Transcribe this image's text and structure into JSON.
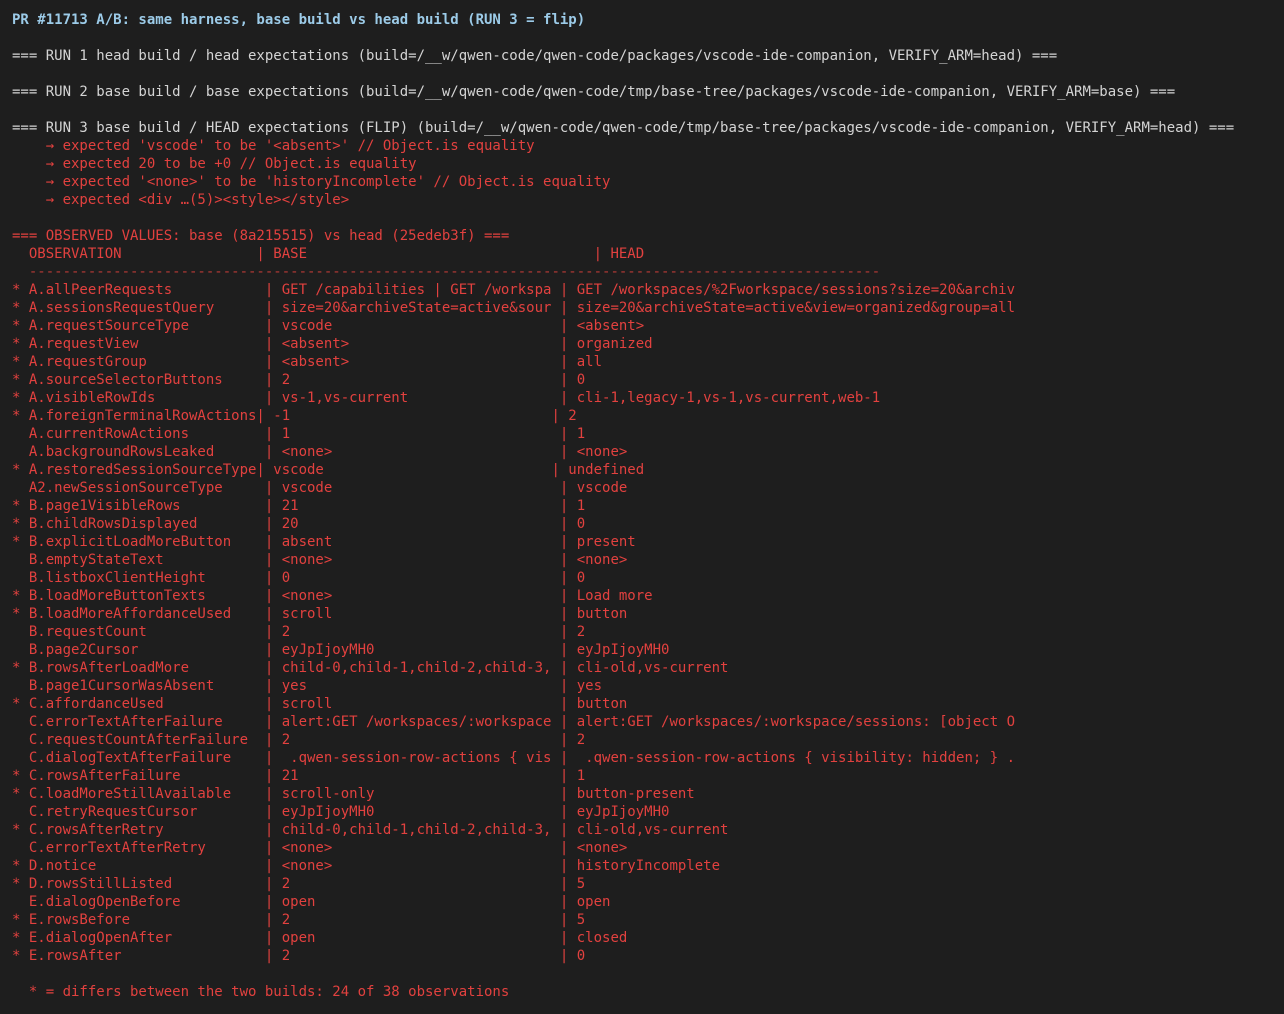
{
  "title": "PR #11713 A/B: same harness, base build vs head build (RUN 3 = flip)",
  "runs": [
    "=== RUN 1 head build / head expectations (build=/__w/qwen-code/qwen-code/packages/vscode-ide-companion, VERIFY_ARM=head) ===",
    "=== RUN 2 base build / base expectations (build=/__w/qwen-code/qwen-code/tmp/base-tree/packages/vscode-ide-companion, VERIFY_ARM=base) ===",
    "=== RUN 3 base build / HEAD expectations (FLIP) (build=/__w/qwen-code/qwen-code/tmp/base-tree/packages/vscode-ide-companion, VERIFY_ARM=head) ==="
  ],
  "failures": [
    "    → expected 'vscode' to be '<absent>' // Object.is equality",
    "    → expected 20 to be +0 // Object.is equality",
    "    → expected '<none>' to be 'historyIncomplete' // Object.is equality",
    "    → expected <div …(5)><style></style>"
  ],
  "observed_header": "=== OBSERVED VALUES: base (8a215515) vs head (25edeb3f) ===",
  "table_header": "  OBSERVATION                | BASE                                  | HEAD",
  "table_separator": "  -----------------------------------------------------------------------------------------------------",
  "rows": [
    "* A.allPeerRequests           | GET /capabilities | GET /workspa | GET /workspaces/%2Fworkspace/sessions?size=20&archiv",
    "* A.sessionsRequestQuery      | size=20&archiveState=active&sour | size=20&archiveState=active&view=organized&group=all",
    "* A.requestSourceType         | vscode                           | <absent>",
    "* A.requestView               | <absent>                         | organized",
    "* A.requestGroup              | <absent>                         | all",
    "* A.sourceSelectorButtons     | 2                                | 0",
    "* A.visibleRowIds             | vs-1,vs-current                  | cli-1,legacy-1,vs-1,vs-current,web-1",
    "* A.foreignTerminalRowActions| -1                               | 2",
    "  A.currentRowActions         | 1                                | 1",
    "  A.backgroundRowsLeaked      | <none>                           | <none>",
    "* A.restoredSessionSourceType| vscode                           | undefined",
    "  A2.newSessionSourceType     | vscode                           | vscode",
    "* B.page1VisibleRows          | 21                               | 1",
    "* B.childRowsDisplayed        | 20                               | 0",
    "* B.explicitLoadMoreButton    | absent                           | present",
    "  B.emptyStateText            | <none>                           | <none>",
    "  B.listboxClientHeight       | 0                                | 0",
    "* B.loadMoreButtonTexts       | <none>                           | Load more",
    "* B.loadMoreAffordanceUsed    | scroll                           | button",
    "  B.requestCount              | 2                                | 2",
    "  B.page2Cursor               | eyJpIjoyMH0                      | eyJpIjoyMH0",
    "* B.rowsAfterLoadMore         | child-0,child-1,child-2,child-3, | cli-old,vs-current",
    "  B.page1CursorWasAbsent      | yes                              | yes",
    "* C.affordanceUsed            | scroll                           | button",
    "  C.errorTextAfterFailure     | alert:GET /workspaces/:workspace | alert:GET /workspaces/:workspace/sessions: [object O",
    "  C.requestCountAfterFailure  | 2                                | 2",
    "  C.dialogTextAfterFailure    |  .qwen-session-row-actions { vis |  .qwen-session-row-actions { visibility: hidden; } .",
    "* C.rowsAfterFailure          | 21                               | 1",
    "* C.loadMoreStillAvailable    | scroll-only                      | button-present",
    "  C.retryRequestCursor        | eyJpIjoyMH0                      | eyJpIjoyMH0",
    "* C.rowsAfterRetry            | child-0,child-1,child-2,child-3, | cli-old,vs-current",
    "  C.errorTextAfterRetry       | <none>                           | <none>",
    "* D.notice                    | <none>                           | historyIncomplete",
    "* D.rowsStillListed           | 2                                | 5",
    "  E.dialogOpenBefore          | open                             | open",
    "* E.rowsBefore                | 2                                | 5",
    "* E.dialogOpenAfter           | open                             | closed",
    "* E.rowsAfter                 | 2                                | 0"
  ],
  "footnote": "  * = differs between the two builds: 24 of 38 observations"
}
